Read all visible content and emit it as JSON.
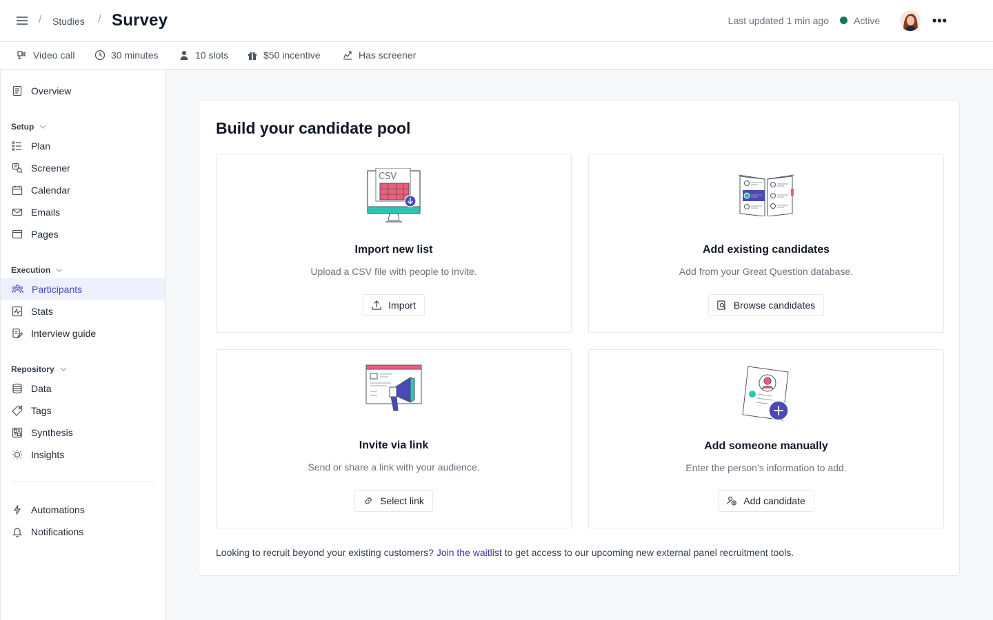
{
  "header": {
    "breadcrumb_parent": "Studies",
    "title": "Survey",
    "last_updated": "Last updated 1 min ago",
    "status": "Active",
    "status_color": "#0f7a55",
    "more_label": "•••"
  },
  "meta": [
    {
      "icon": "video-call-icon",
      "label": "Video call"
    },
    {
      "icon": "clock-icon",
      "label": "30 minutes"
    },
    {
      "icon": "person-icon",
      "label": "10 slots"
    },
    {
      "icon": "gift-icon",
      "label": "$50 incentive"
    },
    {
      "icon": "screener-icon",
      "label": "Has screener"
    }
  ],
  "sidebar": {
    "overview": "Overview",
    "setup_title": "Setup",
    "setup_items": [
      "Plan",
      "Screener",
      "Calendar",
      "Emails",
      "Pages"
    ],
    "execution_title": "Execution",
    "execution_items": [
      "Participants",
      "Stats",
      "Interview guide"
    ],
    "repository_title": "Repository",
    "repository_items": [
      "Data",
      "Tags",
      "Synthesis",
      "Insights"
    ],
    "bottom_items": [
      "Automations",
      "Notifications"
    ],
    "active_item": "Participants",
    "active_color": "#4a49b6"
  },
  "main": {
    "title": "Build your candidate pool",
    "options": [
      {
        "title": "Import new list",
        "desc": "Upload a CSV file with people to invite.",
        "button": "Import",
        "illus_text": "CSV"
      },
      {
        "title": "Add existing candidates",
        "desc": "Add from your Great Question database.",
        "button": "Browse candidates"
      },
      {
        "title": "Invite via link",
        "desc": "Send or share a link with your audience.",
        "button": "Select link"
      },
      {
        "title": "Add someone manually",
        "desc": "Enter the person’s information to add.",
        "button": "Add candidate"
      }
    ],
    "footer_before": "Looking to recruit beyond your existing customers? ",
    "footer_link": "Join the waitlist",
    "footer_after": " to get access to our upcoming new external panel recruitment tools.",
    "link_color": "#3b3aa8"
  }
}
